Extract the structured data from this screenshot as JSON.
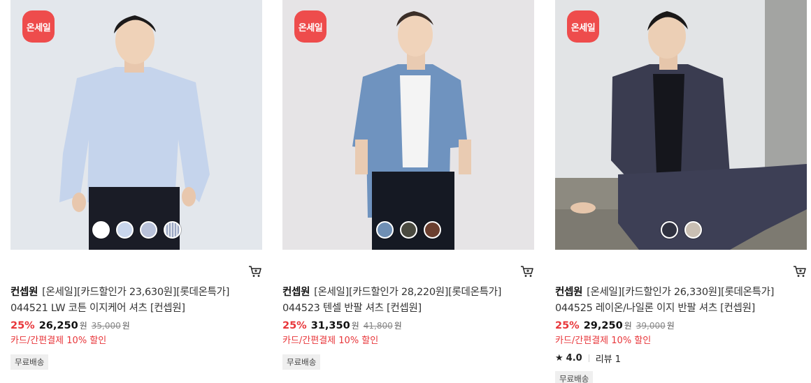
{
  "products": [
    {
      "badge": "온세일",
      "brand": "컨셉원",
      "title": "[온세일][카드할인가 23,630원][롯데온특가] 044521 LW 코튼 이지케어 셔츠 [컨셉원]",
      "discount_rate": "25%",
      "price": "26,250",
      "currency": "원",
      "original_price": "35,000",
      "original_currency": "원",
      "card_discount": "카드/간편결제 10% 할인",
      "shipping": "무료배송",
      "swatches": [
        "#ffffff",
        "#c9d6ec",
        "#b9c2da",
        "#dfe3ec"
      ]
    },
    {
      "badge": "온세일",
      "brand": "컨셉원",
      "title": "[온세일][카드할인가 28,220원][롯데온특가] 044523 텐셀 반팔 셔츠 [컨셉원]",
      "discount_rate": "25%",
      "price": "31,350",
      "currency": "원",
      "original_price": "41,800",
      "original_currency": "원",
      "card_discount": "카드/간편결제 10% 할인",
      "shipping": "무료배송",
      "swatches": [
        "#6f8fb4",
        "#4a4a40",
        "#6b3f2f"
      ]
    },
    {
      "badge": "온세일",
      "brand": "컨셉원",
      "title": "[온세일][카드할인가 26,330원][롯데온특가] 044525 레이온/나일론 이지 반팔 셔츠 [컨셉원]",
      "discount_rate": "25%",
      "price": "29,250",
      "currency": "원",
      "original_price": "39,000",
      "original_currency": "원",
      "card_discount": "카드/간편결제 10% 할인",
      "rating": "4.0",
      "review": "리뷰 1",
      "shipping": "무료배송",
      "swatches": [
        "#2f3140",
        "#c9bfb3"
      ]
    }
  ],
  "colors": {
    "badge": "#ee4c4c",
    "discount": "#e8363a"
  },
  "icons": {
    "cart": "cart-icon",
    "star": "star-icon"
  }
}
